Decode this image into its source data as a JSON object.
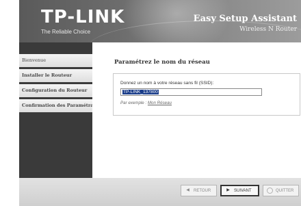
{
  "header": {
    "brand": "TP-LINK",
    "tagline": "The Reliable Choice",
    "title": "Easy Setup Assistant",
    "subtitle": "Wireless N Router"
  },
  "sidebar": {
    "items": [
      {
        "label": "Bienvenue"
      },
      {
        "label": "Installer le Routeur"
      },
      {
        "label": "Configuration du Routeur"
      },
      {
        "label": "Confirmation des Paramétrages"
      }
    ]
  },
  "main": {
    "title": "Paramétrez le nom du réseau",
    "ssid_label": "Donnez un nom à votre réseau sans fil (SSID):",
    "ssid_value": "TP-LINK_137800",
    "example_prefix": "Par exemple : ",
    "example_link": "Mon Réseau"
  },
  "footer": {
    "back_label": "RETOUR",
    "next_label": "SUIVANT",
    "quit_label": "QUITTER"
  },
  "icons": {
    "back": "triangle-left-icon",
    "next": "triangle-right-icon",
    "quit": "circle-icon"
  }
}
